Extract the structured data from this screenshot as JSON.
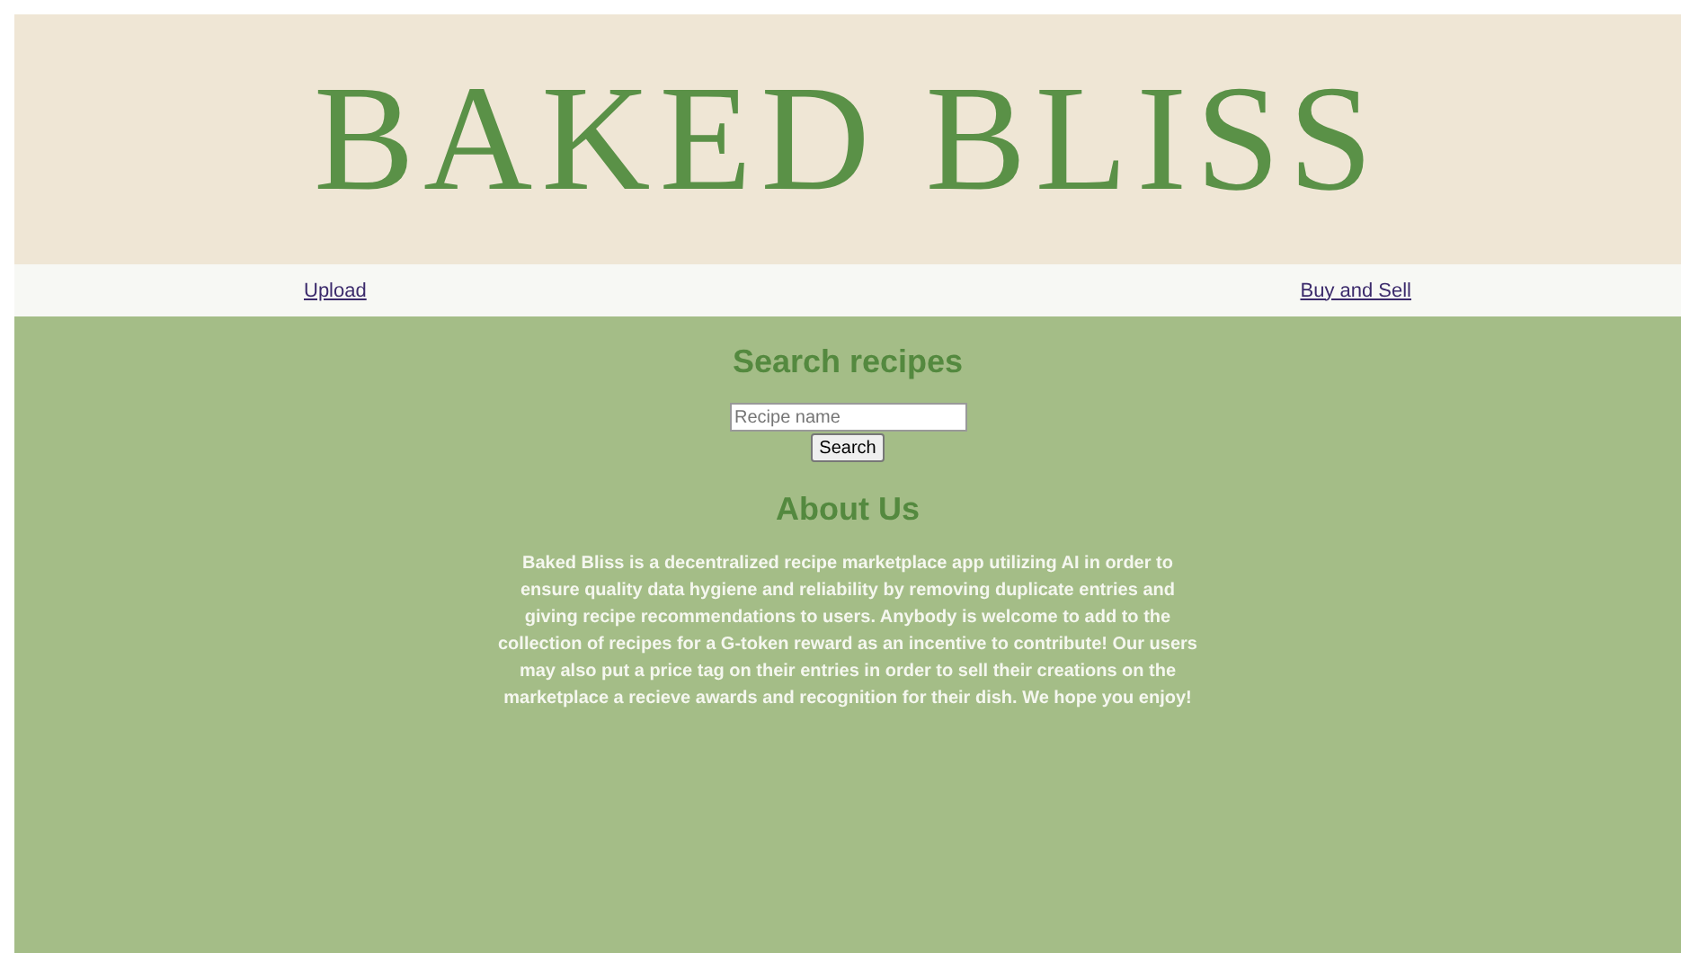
{
  "header": {
    "title": "BAKED BLISS"
  },
  "nav": [
    {
      "label": "Upload"
    },
    {
      "label": "Buy and Sell"
    }
  ],
  "search": {
    "heading": "Search recipes",
    "placeholder": "Recipe name",
    "button": "Search"
  },
  "about": {
    "heading": "About Us",
    "text": "Baked Bliss is a decentralized recipe marketplace app utilizing AI in order to ensure quality data hygiene and reliability by removing duplicate entries and giving recipe recommendations to users. Anybody is welcome to add to the collection of recipes for a G-token reward as an incentive to contribute! Our users may also put a price tag on their entries in order to sell their creations on the marketplace a recieve awards and recognition for their dish. We hope you enjoy!"
  }
}
